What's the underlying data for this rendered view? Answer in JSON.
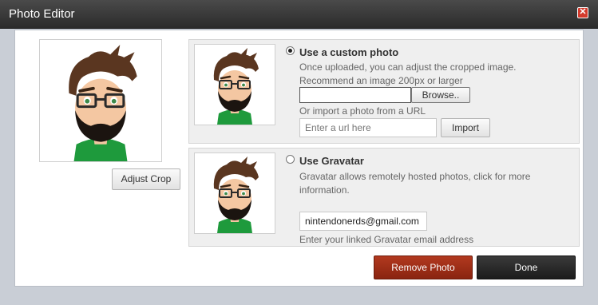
{
  "window": {
    "title": "Photo Editor",
    "close_icon": "close-icon"
  },
  "left": {
    "adjust_crop_label": "Adjust Crop"
  },
  "custom_photo": {
    "title": "Use a custom photo",
    "selected": true,
    "description": "Once uploaded, you can adjust the cropped image.",
    "recommendation": "Recommend an image 200px or larger",
    "browse_label": "Browse..",
    "import_hint": "Or import a photo from a URL",
    "url_placeholder": "Enter a url here",
    "url_value": "",
    "import_label": "Import"
  },
  "gravatar": {
    "title": "Use Gravatar",
    "selected": false,
    "description_line1": "Gravatar allows remotely hosted photos, click for more",
    "description_line2": "information.",
    "email_value": "nintendonerds@gmail.com",
    "email_hint": "Enter your linked Gravatar email address"
  },
  "actions": {
    "remove_label": "Remove Photo",
    "done_label": "Done"
  },
  "colors": {
    "remove_button": "#a0301a",
    "done_button": "#2a2a2a",
    "titlebar": "#333333"
  }
}
